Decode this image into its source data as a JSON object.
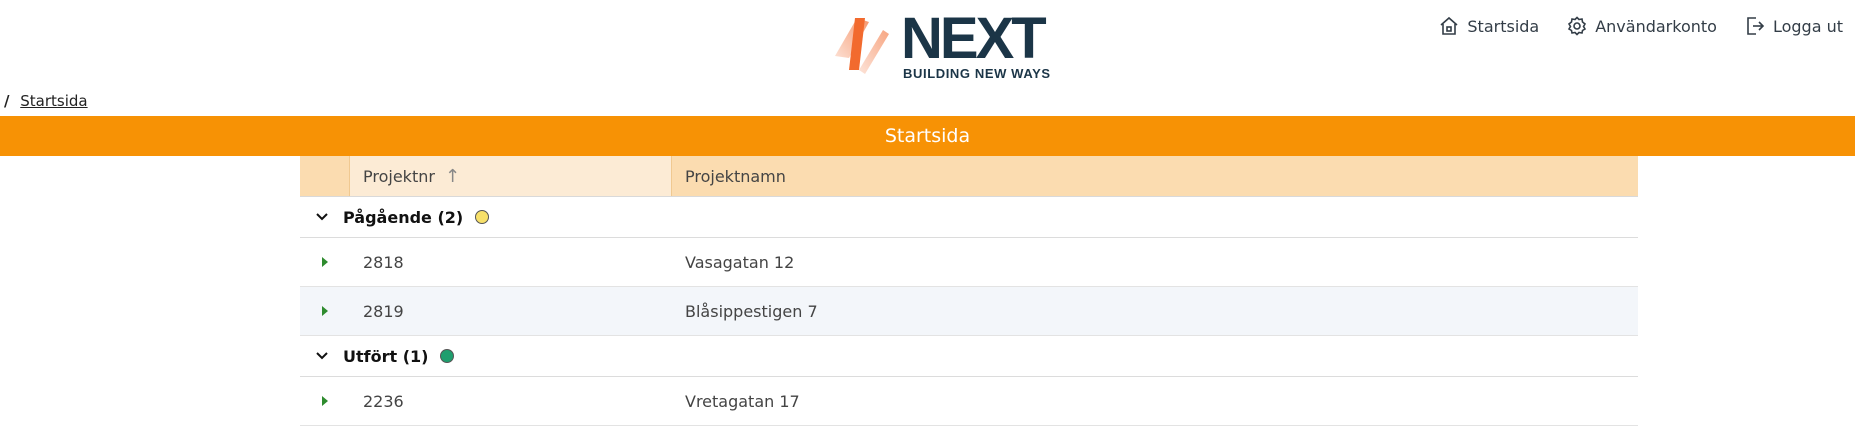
{
  "header": {
    "logo": {
      "wordmark": "NEXT",
      "tagline": "BUILDING NEW WAYS"
    },
    "nav": [
      {
        "label": "Startsida",
        "icon": "home-icon"
      },
      {
        "label": "Användarkonto",
        "icon": "gear-icon"
      },
      {
        "label": "Logga ut",
        "icon": "logout-icon"
      }
    ]
  },
  "breadcrumb": {
    "separator": "/",
    "current": "Startsida"
  },
  "page_title": "Startsida",
  "grid": {
    "columns": {
      "nr": "Projektnr",
      "nr_sort": "↑",
      "name": "Projektnamn"
    },
    "groups": [
      {
        "label": "Pågående (2)",
        "status_color": "#f7e06a",
        "rows": [
          {
            "nr": "2818",
            "name": "Vasagatan 12"
          },
          {
            "nr": "2819",
            "name": "Blåsippestigen 7"
          }
        ]
      },
      {
        "label": "Utfört (1)",
        "status_color": "#1f9e6e",
        "rows": [
          {
            "nr": "2236",
            "name": "Vretagatan 17"
          }
        ]
      }
    ]
  },
  "colors": {
    "accent": "#f79205",
    "brand_dark": "#1b3547",
    "expand_green": "#2e8b2e"
  }
}
